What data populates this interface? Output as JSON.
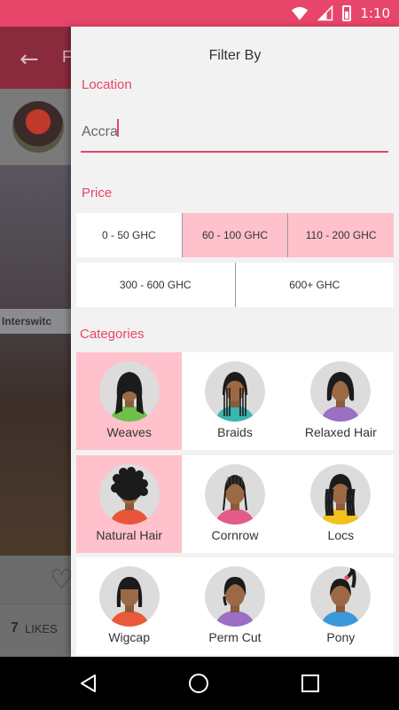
{
  "status_bar": {
    "time": "1:10",
    "icons": [
      "wifi-icon",
      "signal-icon",
      "battery-icon"
    ]
  },
  "background": {
    "title_fragment": "F",
    "sign_text": "Interswitc",
    "likes_count": "7",
    "likes_label": "LIKES"
  },
  "drawer": {
    "title": "Filter By",
    "location": {
      "label": "Location",
      "value": "Accra"
    },
    "price": {
      "label": "Price",
      "options": [
        {
          "label": "0 - 50 GHC",
          "selected": false
        },
        {
          "label": "60 - 100 GHC",
          "selected": true
        },
        {
          "label": "110 - 200 GHC",
          "selected": true
        },
        {
          "label": "300 - 600 GHC",
          "selected": false
        },
        {
          "label": "600+ GHC",
          "selected": false
        }
      ]
    },
    "categories": {
      "label": "Categories",
      "items": [
        {
          "label": "Weaves",
          "selected": true
        },
        {
          "label": "Braids",
          "selected": false
        },
        {
          "label": "Relaxed Hair",
          "selected": false
        },
        {
          "label": "Natural Hair",
          "selected": true
        },
        {
          "label": "Cornrow",
          "selected": false
        },
        {
          "label": "Locs",
          "selected": false
        },
        {
          "label": "Wigcap",
          "selected": false
        },
        {
          "label": "Perm Cut",
          "selected": false
        },
        {
          "label": "Pony",
          "selected": false
        }
      ]
    }
  },
  "colors": {
    "accent": "#e8456a",
    "selected": "#ffc1cc"
  }
}
